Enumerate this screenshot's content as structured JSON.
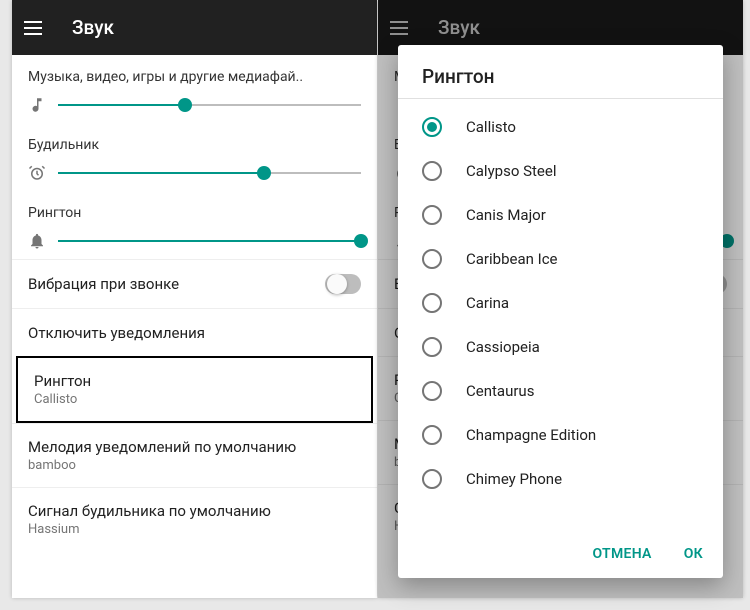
{
  "colors": {
    "accent": "#009688"
  },
  "left": {
    "title": "Звук",
    "media": {
      "label": "Музыка, видео, игры и другие медиафай..",
      "value": 42
    },
    "alarm": {
      "label": "Будильник",
      "value": 68
    },
    "ring": {
      "label": "Рингтон",
      "value": 100
    },
    "vibrate": {
      "label": "Вибрация при звонке",
      "on": false
    },
    "dnd": {
      "label": "Отключить уведомления"
    },
    "ringtone": {
      "label": "Рингтон",
      "value": "Callisto"
    },
    "notif_sound": {
      "label": "Мелодия уведомлений по умолчанию",
      "value": "bamboo"
    },
    "alarm_sound": {
      "label": "Сигнал будильника по умолчанию",
      "value": "Hassium"
    }
  },
  "right": {
    "title": "Звук",
    "under": {
      "media": "Му",
      "alarm": "Бу",
      "ring": "Ри",
      "vibrate": "Ви",
      "dnd": "От",
      "ringtone_label": "Ри",
      "ringtone_value": "Cal",
      "notif_label": "Ме",
      "notif_value": "ban",
      "alarm_label": "Си",
      "alarm_value": "Ha"
    },
    "dialog": {
      "title": "Рингтон",
      "options": [
        "Callisto",
        "Calypso Steel",
        "Canis Major",
        "Caribbean Ice",
        "Carina",
        "Cassiopeia",
        "Centaurus",
        "Champagne Edition",
        "Chimey Phone"
      ],
      "selected": 0,
      "cancel": "ОТМЕНА",
      "ok": "ОК"
    }
  }
}
